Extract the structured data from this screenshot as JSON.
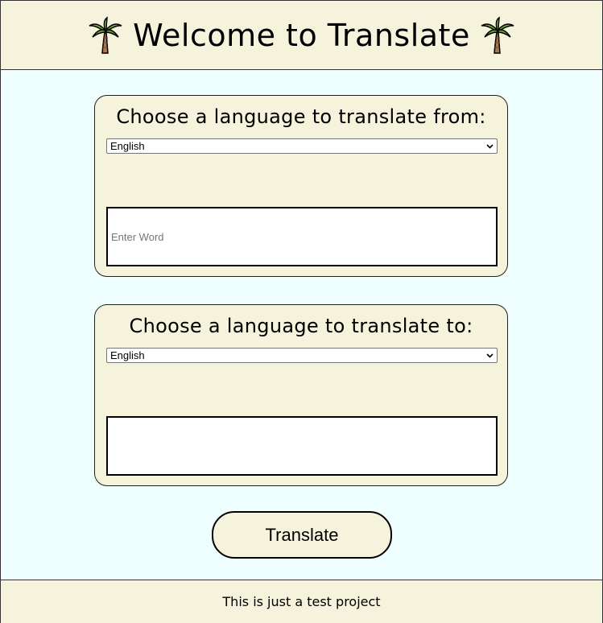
{
  "header": {
    "title": "Welcome to Translate",
    "icon": "palm-tree-icon"
  },
  "from_card": {
    "title": "Choose a language to translate from:",
    "selected_language": "English",
    "input_placeholder": "Enter Word",
    "input_value": ""
  },
  "to_card": {
    "title": "Choose a language to translate to:",
    "selected_language": "English",
    "output_value": ""
  },
  "translate_button": {
    "label": "Translate"
  },
  "footer": {
    "text": "This is just a test project"
  },
  "colors": {
    "page_background": "#efffff",
    "panel_background": "#f5f3dc",
    "border": "#000000"
  }
}
